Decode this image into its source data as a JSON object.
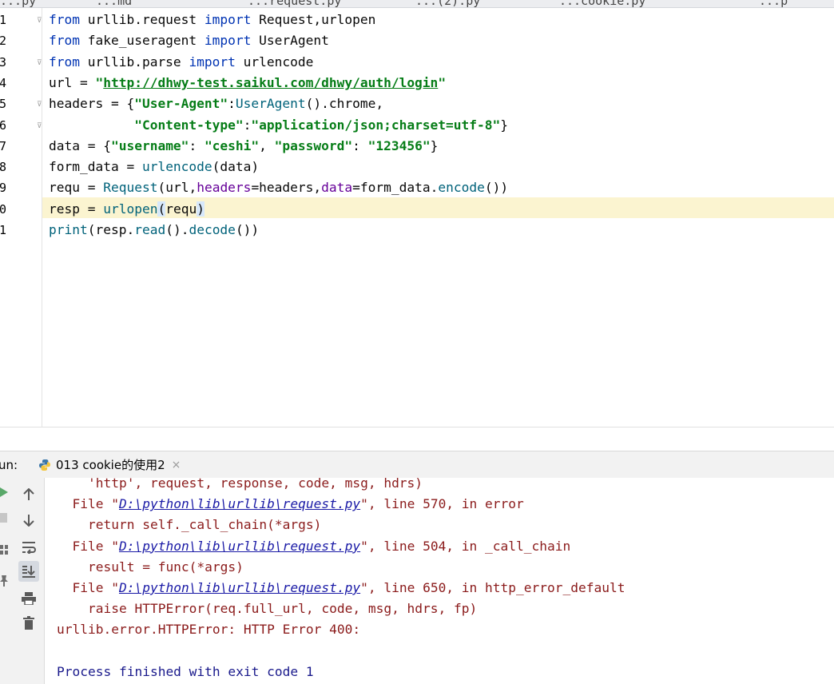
{
  "tabs": [
    {
      "label": "...py"
    },
    {
      "label": "...md"
    },
    {
      "label": "...request.py"
    },
    {
      "label": "...(2).py"
    },
    {
      "label": "...cookie.py"
    },
    {
      "label": "...p"
    }
  ],
  "editor": {
    "line_numbers": [
      "1",
      "2",
      "3",
      "4",
      "5",
      "6",
      "7",
      "8",
      "9",
      "0",
      "1"
    ],
    "active_line_index": 9,
    "lines": [
      [
        "from",
        " urllib.request ",
        "import",
        " Request",
        ",",
        "urlopen"
      ],
      [
        "from",
        " fake_useragent ",
        "import",
        " UserAgent"
      ],
      [
        "from",
        " urllib.parse ",
        "import",
        " urlencode"
      ],
      [
        "url = ",
        "\"",
        "http://dhwy-test.saikul.com/dhwy/auth/login",
        "\""
      ],
      [
        "headers = {",
        "\"User-Agent\"",
        ":",
        "UserAgent",
        "().",
        "chrome",
        ","
      ],
      [
        "           ",
        "\"Content-type\"",
        ":",
        "\"application/json;charset=utf-8\"",
        "}"
      ],
      [
        "data = {",
        "\"username\"",
        ": ",
        "\"ceshi\"",
        ", ",
        "\"password\"",
        ": ",
        "\"123456\"",
        "}"
      ],
      [
        "form_data = ",
        "urlencode",
        "(data)"
      ],
      [
        "requ = ",
        "Request",
        "(url",
        ",",
        "headers",
        "=headers",
        ",",
        "data",
        "=form_data.",
        "encode",
        "())"
      ],
      [
        "resp = ",
        "urlopen",
        "(",
        "requ",
        ")"
      ],
      [
        "print",
        "(resp.",
        "read",
        "().",
        "decode",
        "())"
      ]
    ]
  },
  "run": {
    "label": "un:",
    "tab_name": "013 cookie的使用2",
    "close_glyph": "×"
  },
  "console": {
    "lines": [
      {
        "indent": "    ",
        "parts": [
          {
            "t": "'http', request, response, code, msg, hdrs)",
            "c": "err"
          }
        ]
      },
      {
        "indent": "  ",
        "parts": [
          {
            "t": "File \"",
            "c": "err"
          },
          {
            "t": "D:\\python\\lib\\urllib\\request.py",
            "c": "link"
          },
          {
            "t": "\", line 570, in error",
            "c": "err"
          }
        ]
      },
      {
        "indent": "    ",
        "parts": [
          {
            "t": "return self._call_chain(*args)",
            "c": "err"
          }
        ]
      },
      {
        "indent": "  ",
        "parts": [
          {
            "t": "File \"",
            "c": "err"
          },
          {
            "t": "D:\\python\\lib\\urllib\\request.py",
            "c": "link"
          },
          {
            "t": "\", line 504, in _call_chain",
            "c": "err"
          }
        ]
      },
      {
        "indent": "    ",
        "parts": [
          {
            "t": "result = func(*args)",
            "c": "err"
          }
        ]
      },
      {
        "indent": "  ",
        "parts": [
          {
            "t": "File \"",
            "c": "err"
          },
          {
            "t": "D:\\python\\lib\\urllib\\request.py",
            "c": "link"
          },
          {
            "t": "\", line 650, in http_error_default",
            "c": "err"
          }
        ]
      },
      {
        "indent": "    ",
        "parts": [
          {
            "t": "raise HTTPError(req.full_url, code, msg, hdrs, fp)",
            "c": "err"
          }
        ]
      },
      {
        "indent": "",
        "parts": [
          {
            "t": "urllib.error.HTTPError: HTTP Error 400:",
            "c": "err"
          }
        ]
      },
      {
        "indent": "",
        "parts": []
      },
      {
        "indent": "",
        "parts": [
          {
            "t": "Process finished with exit code 1",
            "c": "normal"
          }
        ]
      }
    ]
  },
  "colors": {
    "keyword": "#0033b3",
    "string": "#067d17",
    "function": "#00627a",
    "named_arg": "#660099",
    "error_text": "#8b1b1b",
    "caret_row": "#fbf4d0",
    "run_tab_underline": "#4083c9"
  }
}
